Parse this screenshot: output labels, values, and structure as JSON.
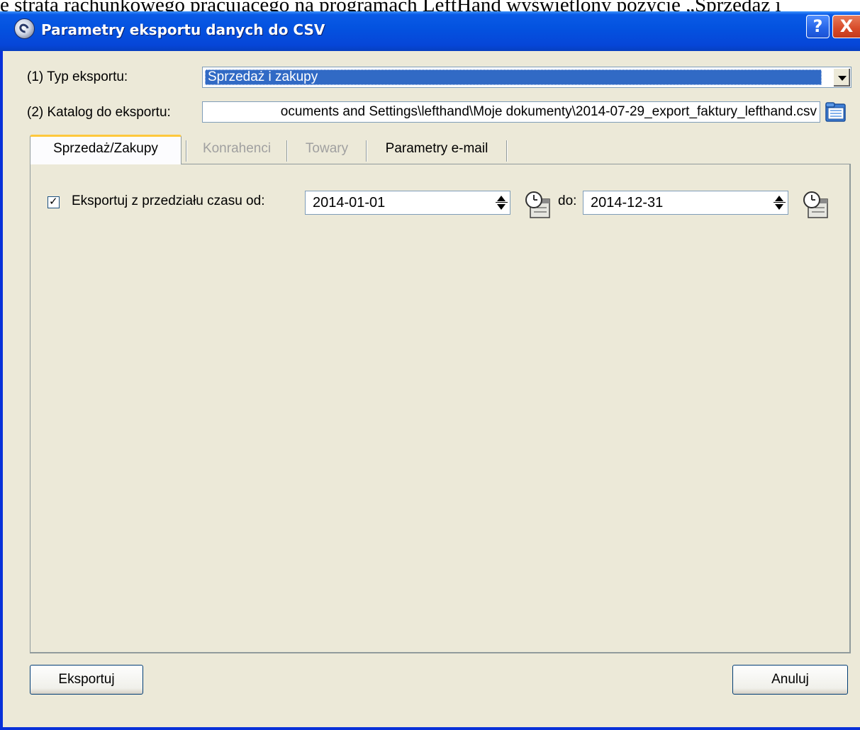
{
  "background_caption": "e strata rachunkowego pracującego na programach LeftHand wyświetlony pozycję „Sprzedaż i",
  "window": {
    "title": "Parametry eksportu danych do CSV",
    "help_label": "?",
    "close_label": "X"
  },
  "form": {
    "export_type_label": "(1) Typ eksportu:",
    "export_type_value": "Sprzedaż i zakupy",
    "directory_label": "(2) Katalog do eksportu:",
    "directory_value": "ocuments and Settings\\lefthand\\Moje dokumenty\\2014-07-29_export_faktury_lefthand.csv"
  },
  "tabs": [
    {
      "label": "Sprzedaż/Zakupy",
      "state": "active"
    },
    {
      "label": "Konrahenci",
      "state": "disabled"
    },
    {
      "label": "Towary",
      "state": "disabled"
    },
    {
      "label": "Parametry e-mail",
      "state": "enabled"
    }
  ],
  "sales_tab": {
    "checkbox_label": "Eksportuj z przedziału czasu od:",
    "checkbox_checked": true,
    "date_from": "2014-01-01",
    "to_label": "do:",
    "date_to": "2014-12-31"
  },
  "buttons": {
    "export": "Eksportuj",
    "cancel": "Anuluj"
  },
  "colors": {
    "titlebar": "#0a5ae6",
    "client_background": "#ece9d8",
    "selection": "#316ac5",
    "close_button": "#d74a28"
  }
}
